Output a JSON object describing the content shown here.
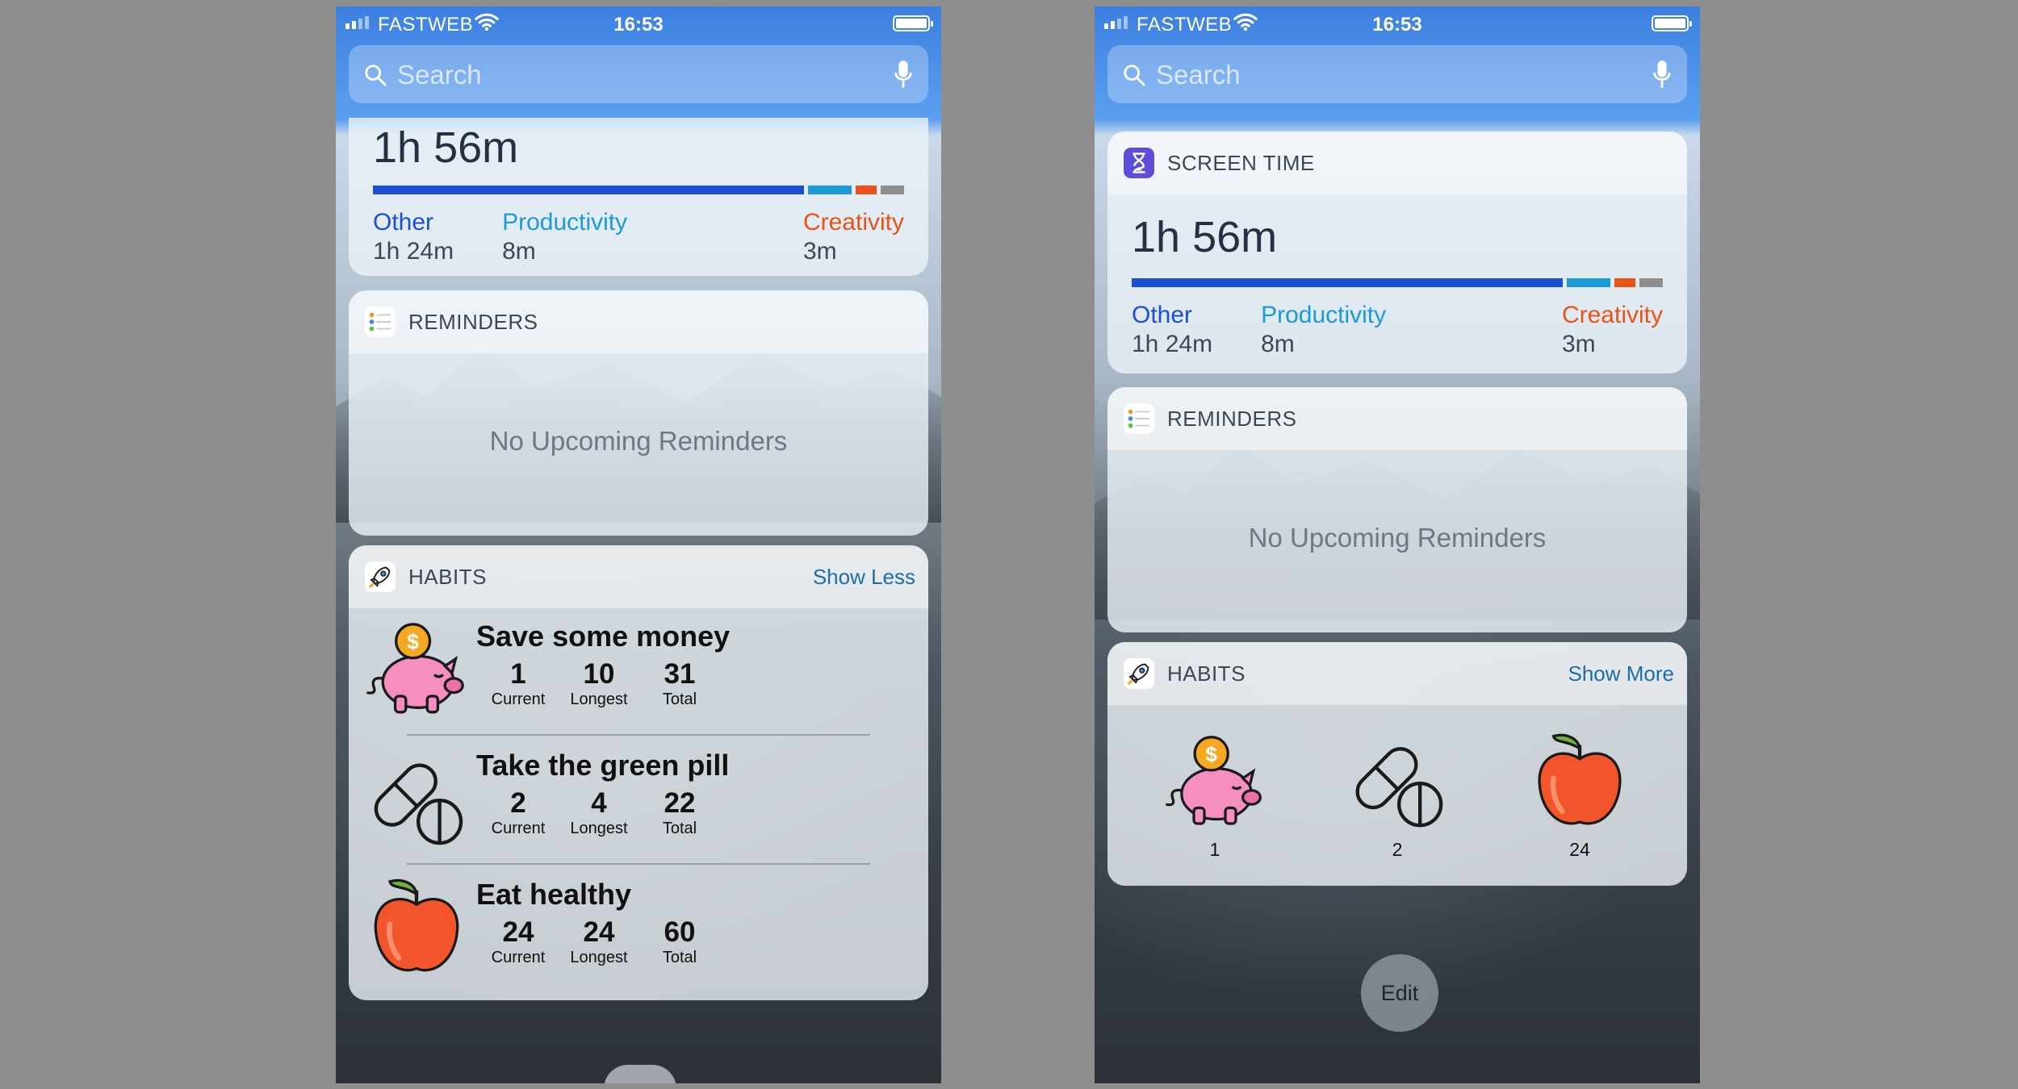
{
  "statusbar": {
    "carrier": "FASTWEB",
    "time": "16:53"
  },
  "search": {
    "placeholder": "Search"
  },
  "screen_time": {
    "title": "SCREEN TIME",
    "total": "1h 56m",
    "categories": [
      {
        "name": "Other",
        "value": "1h 24m",
        "color": "#1b4fd1"
      },
      {
        "name": "Productivity",
        "value": "8m",
        "color": "#1c9ad6"
      },
      {
        "name": "Creativity",
        "value": "3m",
        "color": "#e8531a"
      }
    ],
    "bar_fractions": [
      0.83,
      0.085,
      0.04,
      0.045
    ],
    "bar_colors": [
      "#1b4fd1",
      "#1c9ad6",
      "#e8531a",
      "#8e8e8e"
    ]
  },
  "reminders": {
    "title": "REMINDERS",
    "empty": "No Upcoming Reminders"
  },
  "habits": {
    "title": "HABITS",
    "show_less": "Show Less",
    "show_more": "Show More",
    "stat_labels": {
      "current": "Current",
      "longest": "Longest",
      "total": "Total"
    },
    "items": [
      {
        "name": "Save some money",
        "icon": "piggy-bank-icon",
        "current": "1",
        "longest": "10",
        "total": "31"
      },
      {
        "name": "Take the green pill",
        "icon": "pill-icon",
        "current": "2",
        "longest": "4",
        "total": "22"
      },
      {
        "name": "Eat healthy",
        "icon": "apple-icon",
        "current": "24",
        "longest": "24",
        "total": "60"
      }
    ]
  },
  "edit": {
    "label": "Edit"
  }
}
